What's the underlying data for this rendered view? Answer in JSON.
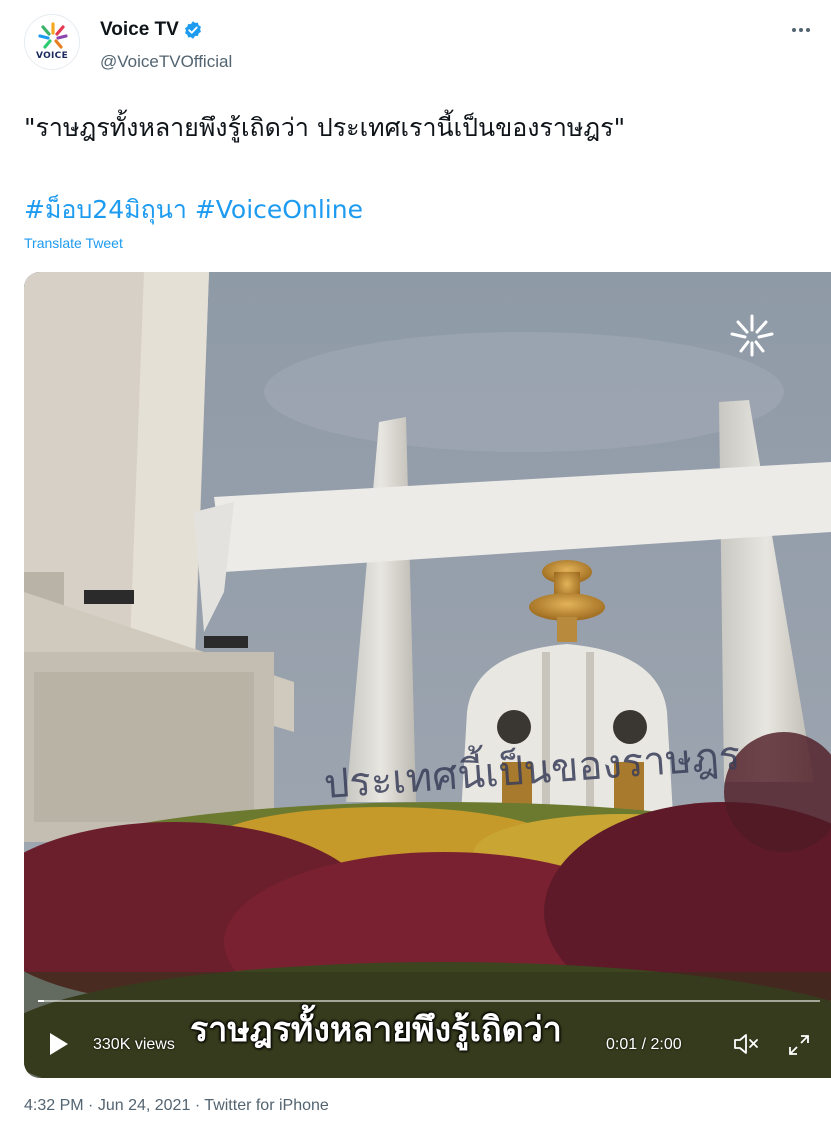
{
  "account": {
    "display_name": "Voice TV",
    "handle": "@VoiceTVOfficial",
    "avatar_text": "VOICE",
    "verified_icon": "verified-badge-icon"
  },
  "tweet": {
    "text": "\"ราษฎรทั้งหลายพึงรู้เถิดว่า ประเทศเรานี้เป็นของราษฎร\"",
    "hashtags": [
      "#ม็อบ24มิถุนา",
      "#VoiceOnline"
    ],
    "translate_label": "Translate Tweet"
  },
  "video": {
    "banner_text": "ประเทศนี้เป็นของราษฎร",
    "subtitle": "ราษฎรทั้งหลายพึงรู้เถิดว่า",
    "views": "330K views",
    "time": "0:01 / 2:00",
    "progress": 0.008,
    "icons": {
      "play": "play-icon",
      "mute": "muted-speaker-icon",
      "fullscreen": "fullscreen-icon",
      "watermark": "voice-logo-icon"
    }
  },
  "footer": {
    "time": "4:32 PM",
    "separator": "·",
    "date": "Jun 24, 2021",
    "source": "Twitter for iPhone"
  },
  "colors": {
    "accent": "#1d9bf0",
    "text": "#0f1419",
    "muted": "#536471"
  }
}
